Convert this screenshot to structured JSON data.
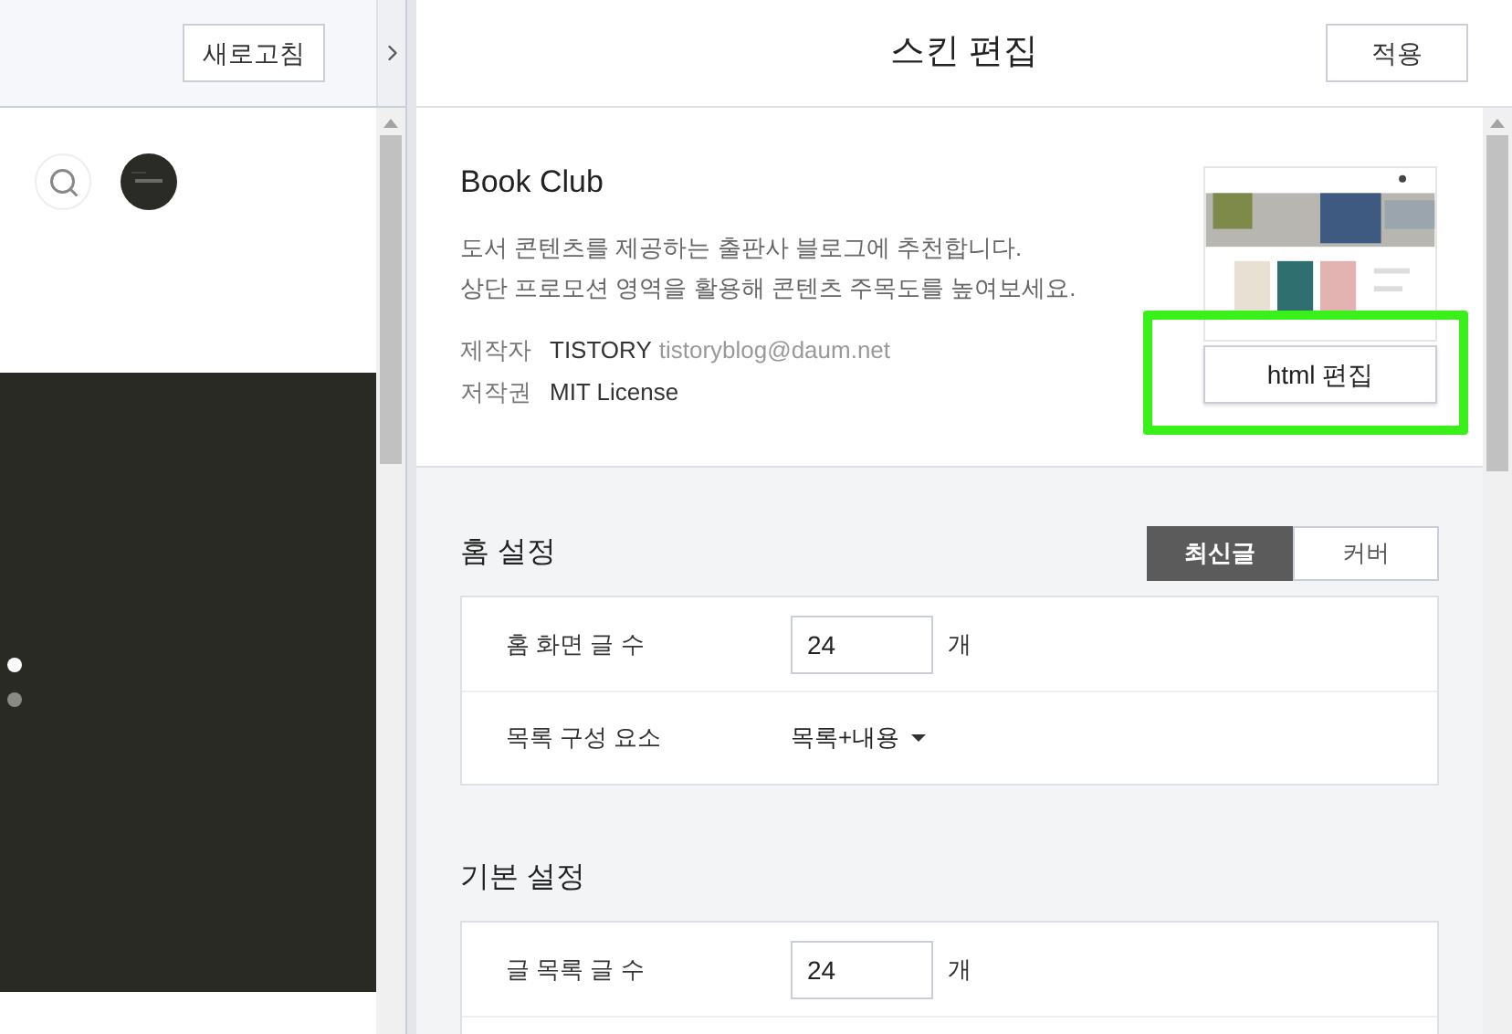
{
  "preview": {
    "refresh_button": "새로고침",
    "carousel_dots": [
      {
        "selected": true
      },
      {
        "selected": false
      }
    ]
  },
  "header": {
    "title": "스킨 편집",
    "apply_button": "적용"
  },
  "skin": {
    "name": "Book Club",
    "description": [
      "도서 콘텐츠를 제공하는 출판사 블로그에 추천합니다.",
      "상단 프로모션 영역을 활용해 콘텐츠 주목도를 높여보세요."
    ],
    "meta": [
      {
        "label": "제작자",
        "value": "TISTORY",
        "extra": "tistoryblog@daum.net"
      },
      {
        "label": "저작권",
        "value": "MIT License"
      }
    ],
    "html_button": "html 편집",
    "highlighted": true
  },
  "sections": [
    {
      "title": "홈 설정",
      "toggle": [
        {
          "label": "최신글",
          "selected": true
        },
        {
          "label": "커버",
          "selected": false
        }
      ],
      "rows": [
        {
          "kind": "number",
          "label": "홈 화면 글 수",
          "value": "24",
          "unit": "개"
        },
        {
          "kind": "select",
          "label": "목록 구성 요소",
          "value": "목록+내용"
        }
      ]
    },
    {
      "title": "기본 설정",
      "rows": [
        {
          "kind": "number",
          "label": "글 목록 글 수",
          "value": "24",
          "unit": "개"
        }
      ]
    }
  ]
}
